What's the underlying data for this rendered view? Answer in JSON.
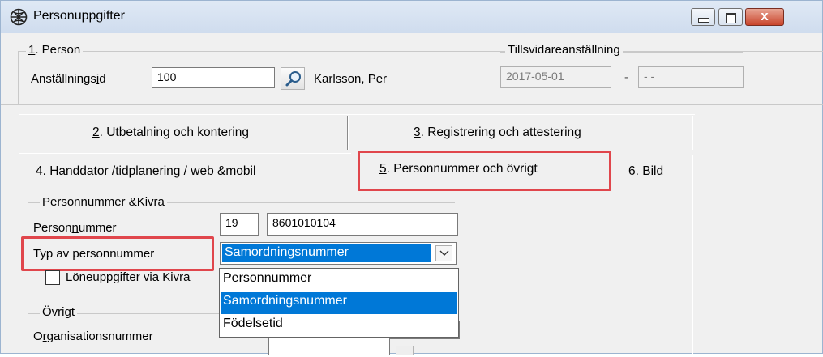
{
  "window": {
    "title": "Personuppgifter",
    "close_glyph": "x",
    "app_icon": "globe-icon"
  },
  "person_group": {
    "legend_key": "1",
    "legend_rest": ". Person",
    "id_label_pre": "Anställnings",
    "id_label_key": "i",
    "id_label_post": "d",
    "id_value": "100",
    "search_icon": "search-icon",
    "person_name": "Karlsson, Per"
  },
  "tillsvidare": {
    "legend": "Tillsvidareanställning",
    "from_date": "2017-05-01",
    "dash": "-",
    "to_date": "-  -"
  },
  "tabs_row1": [
    {
      "key": "2",
      "rest": ". Utbetalning och kontering"
    },
    {
      "key": "3",
      "rest": ". Registrering och attestering"
    }
  ],
  "tabs_row2": [
    {
      "key": "4",
      "rest": ". Handdator /tidplanering / web &mobil"
    },
    {
      "key": "5",
      "rest": ". Personnummer och övrigt",
      "active": true
    },
    {
      "key": "6",
      "rest": ". Bild"
    }
  ],
  "personnummer_section": {
    "legend": "Personnummer &Kivra",
    "pnr_label_pre": "Person",
    "pnr_label_key": "n",
    "pnr_label_post": "ummer",
    "century": "19",
    "pnr_value": "8601010104",
    "type_label": "Typ av personnummer",
    "type_selected": "Samordningsnummer",
    "type_options": [
      "Personnummer",
      "Samordningsnummer",
      "Födelsetid"
    ],
    "type_selected_index": 1,
    "kivra_checkbox_label": "Löneuppgifter via Kivra",
    "kivra_checked": false
  },
  "ovrigt_section": {
    "legend": "Övrigt",
    "org_label_pre": "O",
    "org_label_key": "r",
    "org_label_post": "ganisationsnummer"
  },
  "colors": {
    "highlight": "#e0464c",
    "selection": "#0078d7",
    "window_bg": "#f0f0f0"
  }
}
